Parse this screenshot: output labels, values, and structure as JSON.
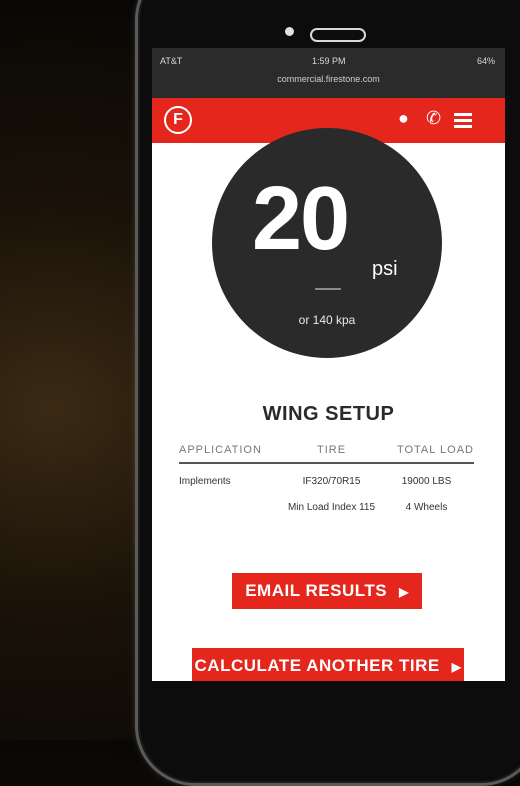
{
  "statusbar": {
    "carrier": "AT&T",
    "time": "1:59 PM",
    "battery": "64%",
    "url": "commercial.firestone.com"
  },
  "navbar": {
    "logo": "F",
    "location_icon": "location-pin-icon",
    "phone_icon": "phone-icon",
    "menu_icon": "hamburger-menu-icon"
  },
  "result": {
    "value": "20",
    "unit": "psi",
    "alt": "or 140 kpa"
  },
  "setup": {
    "title": "WING SETUP",
    "headers": [
      "APPLICATION",
      "TIRE",
      "TOTAL LOAD"
    ],
    "row1": [
      "Implements",
      "IF320/70R15",
      "19000 LBS"
    ],
    "row2": [
      "",
      "Min Load Index 115",
      "4 Wheels"
    ]
  },
  "buttons": {
    "email": "EMAIL RESULTS",
    "calculate": "CALCULATE ANOTHER TIRE"
  },
  "colors": {
    "brand_red": "#e4261d",
    "gauge_dark": "#2a2a2a"
  }
}
